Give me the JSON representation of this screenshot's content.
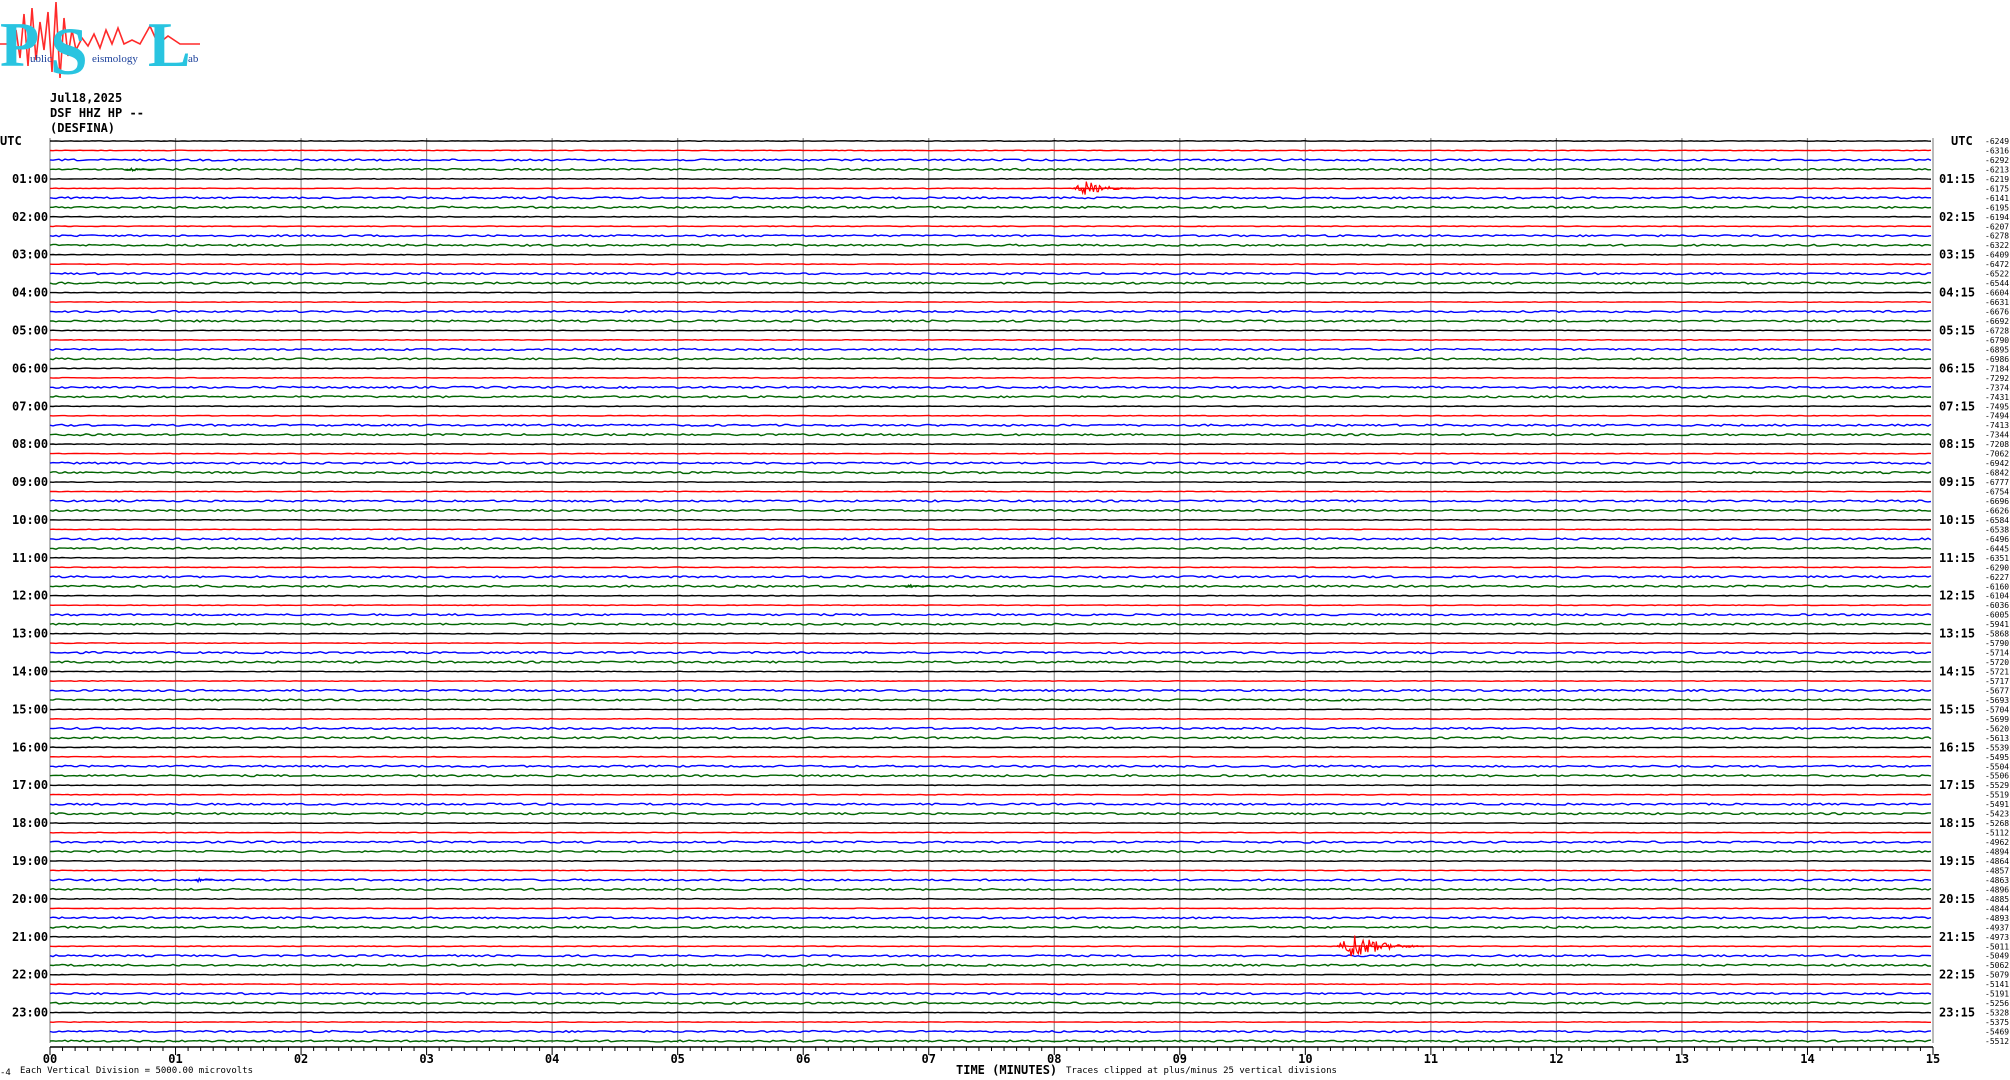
{
  "logo": {
    "letters": [
      "P",
      "S",
      "L"
    ],
    "small_text": [
      "ublic",
      "eismology",
      "ab"
    ],
    "colors": {
      "letters": "#29c4e0",
      "trace": "#ff2a2a",
      "small_text": "#1a3f9a"
    }
  },
  "header": {
    "date": "Jul18,2025",
    "station": "DSF HHZ HP --",
    "location": "(DESFINA)"
  },
  "footer": {
    "division_note": "Each Vertical Division = 5000.00 microvolts",
    "time_label": "TIME (MINUTES)",
    "clip_note": "Traces clipped at plus/minus 25 vertical divisions",
    "corner_mark": "-4"
  },
  "chart_data": {
    "type": "line",
    "title": "",
    "xlabel": "TIME (MINUTES)",
    "ylabel": "",
    "xlim": [
      0,
      15
    ],
    "x_ticks": [
      "00",
      "01",
      "02",
      "03",
      "04",
      "05",
      "06",
      "07",
      "08",
      "09",
      "10",
      "11",
      "12",
      "13",
      "14",
      "15"
    ],
    "row_minutes": 15,
    "row_count": 96,
    "left_axis_label": "UTC",
    "right_axis_label": "UTC",
    "left_hour_labels": [
      "01:00",
      "02:00",
      "03:00",
      "04:00",
      "05:00",
      "06:00",
      "07:00",
      "08:00",
      "09:00",
      "10:00",
      "11:00",
      "12:00",
      "13:00",
      "14:00",
      "15:00",
      "16:00",
      "17:00",
      "18:00",
      "19:00",
      "20:00",
      "21:00",
      "22:00",
      "23:00"
    ],
    "right_hour_labels": [
      "01:15",
      "02:15",
      "03:15",
      "04:15",
      "05:15",
      "06:15",
      "07:15",
      "08:15",
      "09:15",
      "10:15",
      "11:15",
      "12:15",
      "13:15",
      "14:15",
      "15:15",
      "16:15",
      "17:15",
      "18:15",
      "19:15",
      "20:15",
      "21:15",
      "22:15",
      "23:15"
    ],
    "trace_colors": [
      "#000000",
      "#ff0000",
      "#0000ff",
      "#006400"
    ],
    "row_offsets": [
      "-6249",
      "-6316",
      "-6292",
      "-6213",
      "-6219",
      "-6175",
      "-6141",
      "-6195",
      "-6194",
      "-6207",
      "-6278",
      "-6322",
      "-6409",
      "-6472",
      "-6522",
      "-6544",
      "-6604",
      "-6631",
      "-6676",
      "-6692",
      "-6728",
      "-6790",
      "-6895",
      "-6986",
      "-7184",
      "-7292",
      "-7374",
      "-7431",
      "-7495",
      "-7494",
      "-7413",
      "-7344",
      "-7208",
      "-7062",
      "-6942",
      "-6842",
      "-6777",
      "-6754",
      "-6696",
      "-6626",
      "-6584",
      "-6538",
      "-6496",
      "-6445",
      "-6351",
      "-6290",
      "-6227",
      "-6160",
      "-6104",
      "-6036",
      "-6005",
      "-5941",
      "-5868",
      "-5790",
      "-5714",
      "-5720",
      "-5721",
      "-5717",
      "-5677",
      "-5693",
      "-5704",
      "-5699",
      "-5620",
      "-5613",
      "-5539",
      "-5495",
      "-5504",
      "-5506",
      "-5529",
      "-5519",
      "-5491",
      "-5423",
      "-5268",
      "-5112",
      "-4962",
      "-4894",
      "-4864",
      "-4857",
      "-4863",
      "-4896",
      "-4885",
      "-4844",
      "-4893",
      "-4937",
      "-4973",
      "-5011",
      "-5049",
      "-5062",
      "-5079",
      "-5141",
      "-5191",
      "-5256",
      "-5328",
      "-5375",
      "-5469",
      "-5512"
    ],
    "events": [
      {
        "row": 5,
        "minute_start": 8.15,
        "minute_end": 8.65,
        "amplitude": 8
      },
      {
        "row": 85,
        "minute_start": 10.25,
        "minute_end": 10.95,
        "amplitude": 14
      }
    ],
    "minor_events": [
      {
        "row": 3,
        "minute_start": 0.6,
        "minute_end": 0.85,
        "amplitude": 2
      },
      {
        "row": 47,
        "minute_start": 6.8,
        "minute_end": 7.05,
        "amplitude": 2
      },
      {
        "row": 44,
        "minute_start": 8.0,
        "minute_end": 8.1,
        "amplitude": 2
      },
      {
        "row": 78,
        "minute_start": 1.15,
        "minute_end": 1.3,
        "amplitude": 2
      }
    ]
  }
}
